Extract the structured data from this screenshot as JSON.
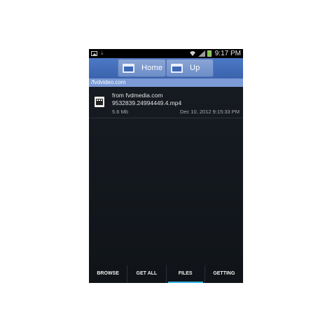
{
  "status_bar": {
    "time": "9:17 PM",
    "icons": [
      "image-icon",
      "download-icon",
      "wifi-icon",
      "signal-icon",
      "battery-icon"
    ]
  },
  "toolbar": {
    "home_label": "Home",
    "up_label": "Up"
  },
  "path": "/fvdvideo.com",
  "files": [
    {
      "source": "from fvdmedia.com",
      "name": "9532839.24994449.4.mp4",
      "size": "5.6 Mb",
      "date": "Dec 10, 2012 9:15:33 PM",
      "icon": "video-file-icon"
    }
  ],
  "tabs": [
    {
      "label": "BROWSE"
    },
    {
      "label": "GET ALL"
    },
    {
      "label": "FILES",
      "active": true
    },
    {
      "label": "GETTING"
    }
  ],
  "colors": {
    "toolbar": "#3a62ad",
    "path_bar": "#7b9ad6",
    "active_tab_indicator": "#33b5e5",
    "battery": "#7ec83a"
  }
}
